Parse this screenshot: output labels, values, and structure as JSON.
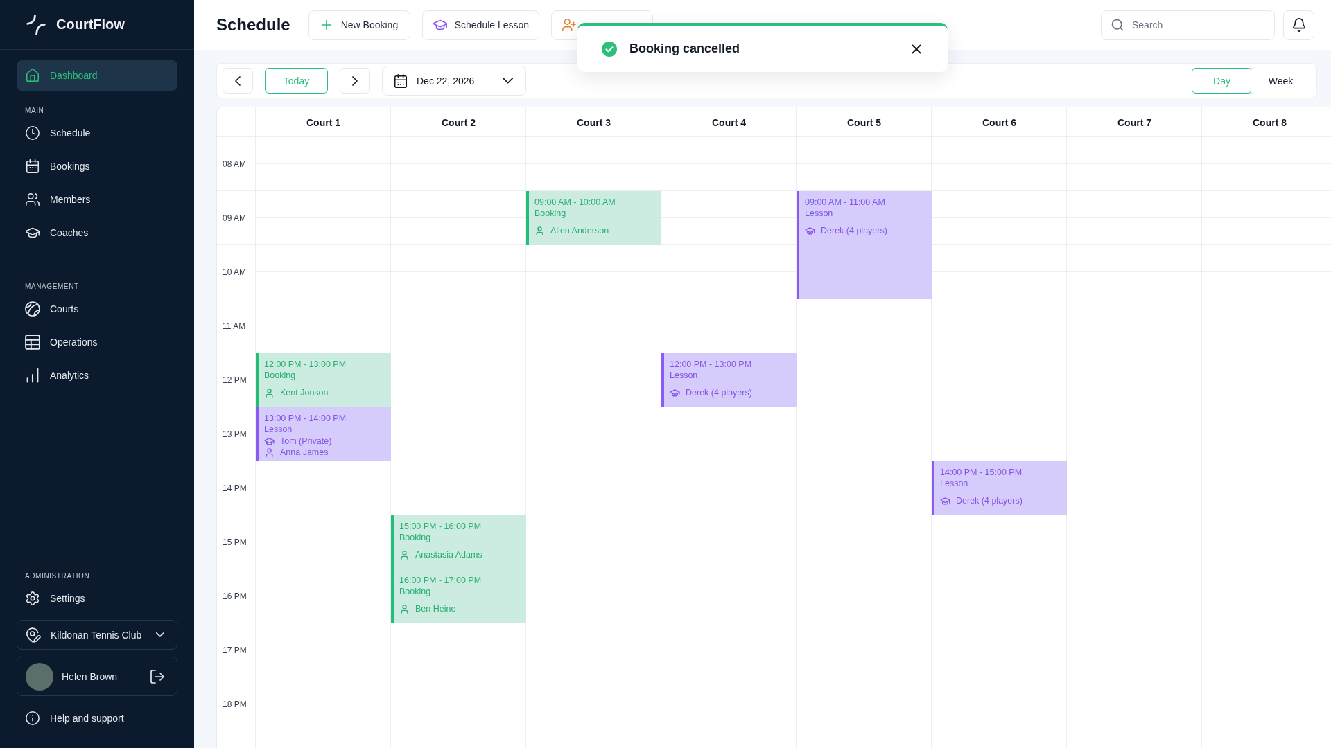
{
  "sidebar": {
    "brand": "CourtFlow",
    "nav": [
      {
        "label": "Dashboard",
        "kind": "home",
        "selected": true
      }
    ],
    "sections": [
      {
        "title": "MAIN",
        "items": [
          {
            "label": "Schedule",
            "kind": "schedule",
            "selected": false
          },
          {
            "label": "Bookings",
            "kind": "bookings",
            "selected": false
          },
          {
            "label": "Members",
            "kind": "members",
            "selected": false
          },
          {
            "label": "Coaches",
            "kind": "coaches",
            "selected": false
          }
        ]
      },
      {
        "title": "MANAGEMENT",
        "items": [
          {
            "label": "Courts",
            "kind": "courts",
            "selected": false
          },
          {
            "label": "Operations",
            "kind": "operations",
            "selected": false
          },
          {
            "label": "Analytics",
            "kind": "analytics",
            "selected": false
          }
        ]
      }
    ],
    "admin": {
      "title": "ADMINISTRATION",
      "items": [
        {
          "label": "Settings",
          "kind": "settings",
          "selected": false
        }
      ]
    },
    "club": {
      "value": "Kildonan Tennis Club"
    },
    "user": {
      "name": "Helen Brown"
    },
    "help": {
      "label": "Help and support"
    }
  },
  "header": {
    "title": "Schedule",
    "actions": [
      {
        "label": "New Booking",
        "kind": "booking"
      },
      {
        "label": "Schedule Lesson",
        "kind": "lesson"
      },
      {
        "kind": "member"
      }
    ],
    "search": {
      "placeholder": "Search"
    }
  },
  "toast": {
    "message": "Booking cancelled"
  },
  "toolbar": {
    "today": "Today",
    "date": "Dec 22, 2026",
    "views": [
      {
        "label": "Day",
        "selected": true
      },
      {
        "label": "Week",
        "selected": false
      }
    ]
  },
  "calendar": {
    "hours": [
      "08 AM",
      "09 AM",
      "10 AM",
      "11 AM",
      "12 PM",
      "13 PM",
      "14 PM",
      "15 PM",
      "16 PM",
      "17 PM",
      "18 PM"
    ],
    "courts": [
      {
        "name": "Court 1",
        "events": [
          {
            "time": "12:00 PM - 13:00 PM",
            "kind": "booking",
            "title": "Booking",
            "people": [
              {
                "name": "Kent Jonson",
                "kind": "member"
              }
            ]
          },
          {
            "time": "13:00 PM - 14:00 PM",
            "kind": "lesson",
            "title": "Lesson",
            "people": [
              {
                "name": "Tom (Private)",
                "kind": "coach"
              },
              {
                "name": "Anna James",
                "kind": "member"
              }
            ]
          }
        ]
      },
      {
        "name": "Court 2",
        "events": [
          {
            "time": "15:00 PM - 16:00 PM",
            "kind": "booking",
            "title": "Booking",
            "people": [
              {
                "name": "Anastasia Adams",
                "kind": "member"
              }
            ]
          },
          {
            "time": "16:00 PM - 17:00 PM",
            "kind": "booking",
            "title": "Booking",
            "people": [
              {
                "name": "Ben Heine",
                "kind": "member"
              }
            ]
          }
        ]
      },
      {
        "name": "Court 3",
        "events": [
          {
            "time": "09:00 AM - 10:00 AM",
            "kind": "booking",
            "title": "Booking",
            "people": [
              {
                "name": "Allen Anderson",
                "kind": "member"
              }
            ]
          }
        ]
      },
      {
        "name": "Court 4",
        "events": [
          {
            "time": "12:00 PM - 13:00 PM",
            "kind": "lesson",
            "title": "Lesson",
            "people": [
              {
                "name": "Derek (4 players)",
                "kind": "coach"
              }
            ]
          }
        ]
      },
      {
        "name": "Court 5",
        "events": [
          {
            "time": "09:00 AM - 11:00 AM",
            "kind": "lesson",
            "title": "Lesson",
            "people": [
              {
                "name": "Derek (4 players)",
                "kind": "coach"
              }
            ]
          }
        ]
      },
      {
        "name": "Court 6",
        "events": [
          {
            "time": "14:00 PM - 15:00 PM",
            "kind": "lesson",
            "title": "Lesson",
            "people": [
              {
                "name": "Derek (4 players)",
                "kind": "coach"
              }
            ]
          }
        ]
      },
      {
        "name": "Court 7"
      },
      {
        "name": "Court 8"
      }
    ]
  }
}
